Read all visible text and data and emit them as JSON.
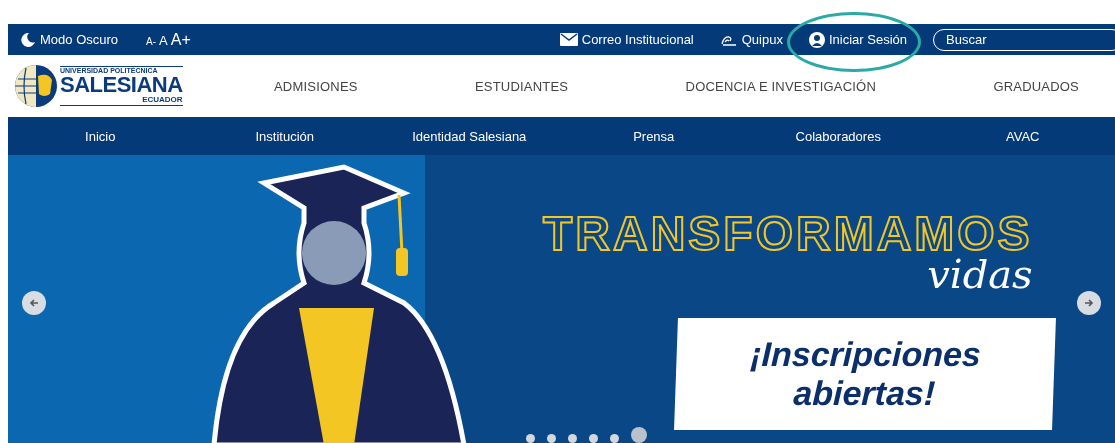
{
  "top_bar": {
    "dark_mode": {
      "label": "Modo Oscuro"
    },
    "font_sizes": [
      {
        "label": "A-",
        "kind": "small"
      },
      {
        "label": "A",
        "kind": "medium"
      },
      {
        "label": "A+",
        "kind": "large"
      }
    ],
    "links": [
      {
        "label": "Correo Institucional",
        "kind": "mail",
        "circled": false
      },
      {
        "label": "Quipux",
        "kind": "quipux",
        "circled": false
      },
      {
        "label": "Iniciar Sesión",
        "kind": "user",
        "circled": true
      }
    ],
    "search": {
      "placeholder": "Buscar"
    }
  },
  "logo": {
    "top": "UNIVERSIDAD POLITÉCNICA",
    "name": "SALESIANA",
    "country": "ECUADOR"
  },
  "main_nav": [
    "ADMISIONES",
    "ESTUDIANTES",
    "DOCENCIA E INVESTIGACIÓN",
    "GRADUADOS"
  ],
  "sub_nav": [
    "Inicio",
    "Institución",
    "Identidad Salesiana",
    "Prensa",
    "Colaboradores",
    "AVAC"
  ],
  "hero": {
    "title": "TRANSFORMAMOS",
    "script": "vidas",
    "banner": [
      "¡Inscripciones",
      "abiertas!"
    ],
    "dots": [
      {
        "selected": false
      },
      {
        "selected": false
      },
      {
        "selected": false
      },
      {
        "selected": false
      },
      {
        "selected": false
      },
      {
        "selected": true
      }
    ]
  }
}
